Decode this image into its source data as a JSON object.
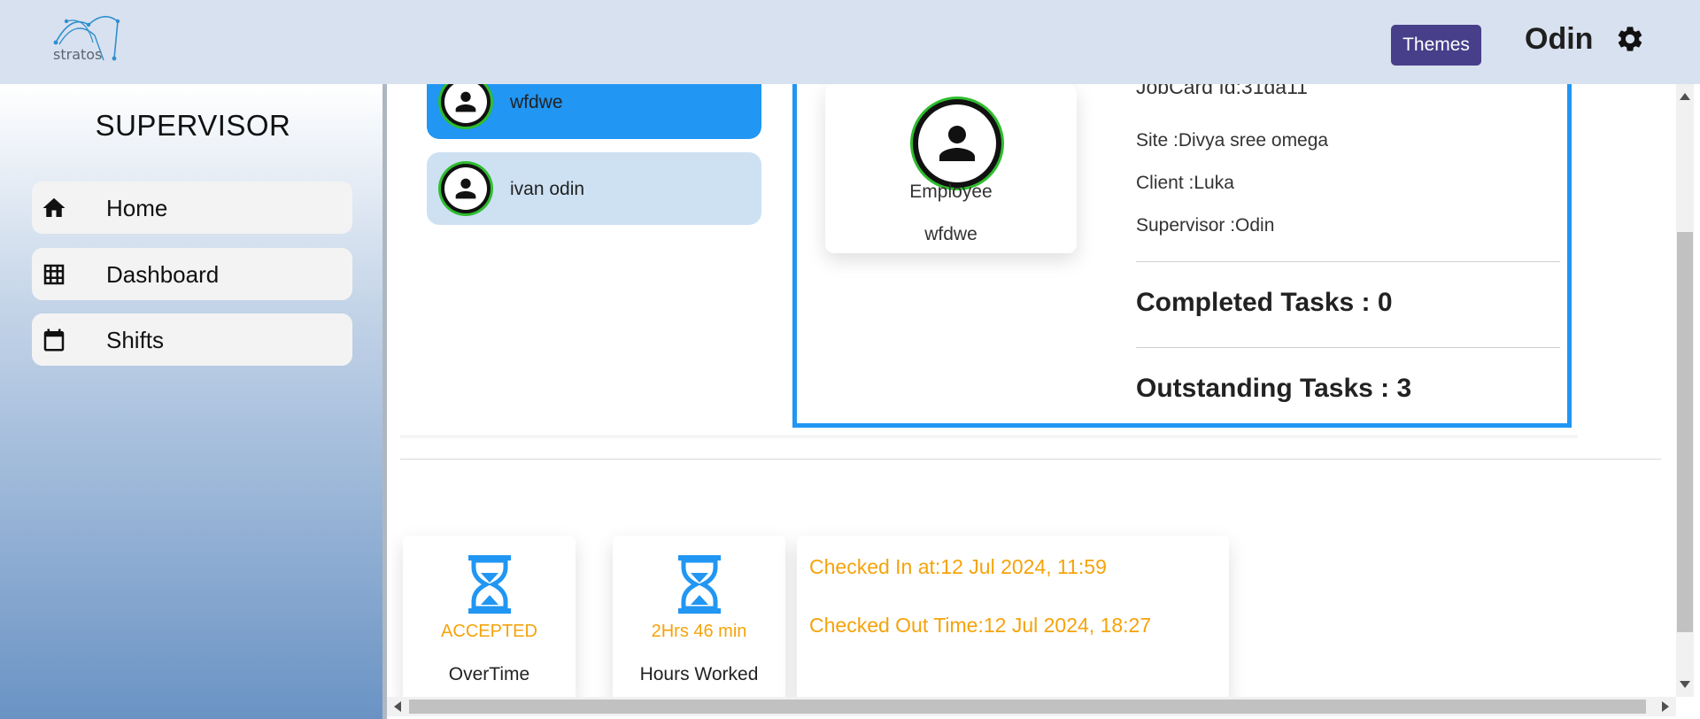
{
  "header": {
    "logo_text": "stratos",
    "themes_label": "Themes",
    "user_name": "Odin",
    "icons": {
      "settings": "gear-icon",
      "logo": "stratos-logo"
    }
  },
  "sidebar": {
    "title": "SUPERVISOR",
    "items": [
      {
        "label": "Home",
        "icon": "home-icon"
      },
      {
        "label": "Dashboard",
        "icon": "grid-icon"
      },
      {
        "label": "Shifts",
        "icon": "calendar-icon"
      }
    ]
  },
  "employees": [
    {
      "name": "wfdwe",
      "active": true
    },
    {
      "name": "ivan odin",
      "active": false
    }
  ],
  "profile": {
    "role": "Employee",
    "name": "wfdwe"
  },
  "jobcard": {
    "id_text": "JobCard Id:31da11",
    "site": "Site :Divya sree omega",
    "client": "Client :Luka",
    "supervisor": "Supervisor :Odin",
    "completed": "Completed Tasks : 0",
    "outstanding": "Outstanding Tasks : 3"
  },
  "stats": [
    {
      "value": "ACCEPTED",
      "label": "OverTime",
      "icon": "hourglass-icon"
    },
    {
      "value": "2Hrs 46 min",
      "label": "Hours Worked",
      "icon": "hourglass-icon"
    }
  ],
  "checks": {
    "checked_in": "Checked In at:12 Jul 2024, 11:59",
    "checked_out": "Checked Out Time:12 Jul 2024, 18:27"
  },
  "colors": {
    "header_bg": "#d8e1ef",
    "themes_button": "#473f8a",
    "accent_blue": "#2196f3",
    "avatar_ring": "#2ebd2e",
    "status_orange": "#f5a30a"
  }
}
